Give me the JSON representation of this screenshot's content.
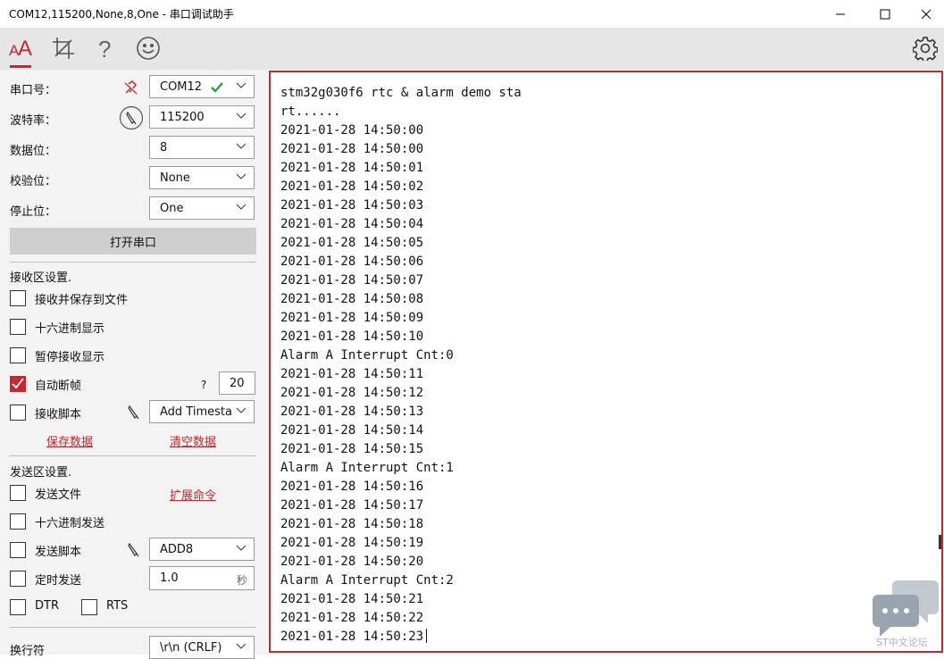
{
  "window": {
    "title": "COM12,115200,None,8,One - 串口调试助手"
  },
  "toolbar": {
    "icons": [
      "font-icon",
      "crop-icon",
      "help-icon",
      "smiley-icon",
      "gear-icon"
    ]
  },
  "serial": {
    "port_label": "串口号：",
    "port_value": "COM12",
    "baud_label": "波特率：",
    "baud_value": "115200",
    "databits_label": "数据位：",
    "databits_value": "8",
    "parity_label": "校验位：",
    "parity_value": "None",
    "stopbits_label": "停止位：",
    "stopbits_value": "One",
    "open_button": "打开串口"
  },
  "receive": {
    "section_label": "接收区设置.",
    "save_to_file": "接收并保存到文件",
    "hex_display": "十六进制显示",
    "pause_display": "暂停接收显示",
    "auto_frame": "自动断帧",
    "auto_frame_checked": true,
    "help_mark": "?",
    "frame_timeout": "20",
    "script_label": "接收脚本",
    "script_value": "Add Timesta",
    "save_data": "保存数据",
    "clear_data": "清空数据"
  },
  "send": {
    "section_label": "发送区设置.",
    "send_file": "发送文件",
    "extend_cmd": "扩展命令",
    "hex_send": "十六进制发送",
    "script_label": "发送脚本",
    "script_value": "ADD8",
    "timer_send": "定时发送",
    "timer_value": "1.0",
    "timer_unit": "秒",
    "dtr": "DTR",
    "rts": "RTS",
    "newline_label": "换行符",
    "newline_value": "\\r\\n (CRLF)"
  },
  "terminal": {
    "lines": [
      "stm32g030f6 rtc & alarm demo sta",
      "rt......",
      "2021-01-28 14:50:00",
      "2021-01-28 14:50:00",
      "2021-01-28 14:50:01",
      "2021-01-28 14:50:02",
      "2021-01-28 14:50:03",
      "2021-01-28 14:50:04",
      "2021-01-28 14:50:05",
      "2021-01-28 14:50:06",
      "2021-01-28 14:50:07",
      "2021-01-28 14:50:08",
      "2021-01-28 14:50:09",
      "2021-01-28 14:50:10",
      "Alarm A Interrupt Cnt:0",
      "2021-01-28 14:50:11",
      "2021-01-28 14:50:12",
      "2021-01-28 14:50:13",
      "2021-01-28 14:50:14",
      "2021-01-28 14:50:15",
      "Alarm A Interrupt Cnt:1",
      "2021-01-28 14:50:16",
      "2021-01-28 14:50:17",
      "2021-01-28 14:50:18",
      "2021-01-28 14:50:19",
      "2021-01-28 14:50:20",
      "Alarm A Interrupt Cnt:2",
      "2021-01-28 14:50:21",
      "2021-01-28 14:50:22",
      "2021-01-28 14:50:23"
    ]
  },
  "watermark": {
    "text": "ST中文论坛"
  },
  "colors": {
    "accent": "#c7272d",
    "port_ok": "#2e9e3a"
  }
}
